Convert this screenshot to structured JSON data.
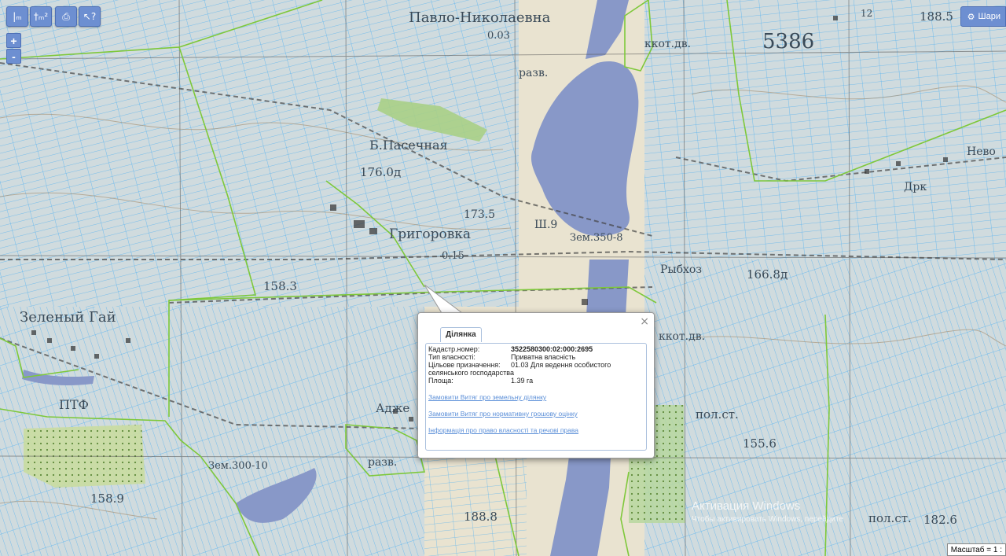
{
  "toolbar": {
    "buttons": [
      {
        "name": "measure-distance-button",
        "glyph": "|ₘ"
      },
      {
        "name": "measure-area-button",
        "glyph": "†ₘ²"
      },
      {
        "name": "print-button",
        "glyph": "⎙"
      },
      {
        "name": "info-cursor-button",
        "glyph": "↖?"
      }
    ],
    "zoom_in": "+",
    "zoom_out": "-",
    "share_label": "Шари"
  },
  "map_labels": [
    {
      "text": "Павло-Николаевна",
      "size": 18
    },
    {
      "text": "0.03",
      "size": 13
    },
    {
      "text": "разв.",
      "size": 14
    },
    {
      "text": "ккот.дв.",
      "size": 14
    },
    {
      "text": "5386",
      "size": 26
    },
    {
      "text": "188.5",
      "size": 15
    },
    {
      "text": "12",
      "size": 12
    },
    {
      "text": "Б.Пасечная",
      "size": 16
    },
    {
      "text": "176.0д",
      "size": 15
    },
    {
      "text": "173.5",
      "size": 14
    },
    {
      "text": "Ш.9",
      "size": 14
    },
    {
      "text": "Григоровка",
      "size": 17
    },
    {
      "text": "0.15",
      "size": 13
    },
    {
      "text": "Зем.350-8",
      "size": 13
    },
    {
      "text": "Рыбхоз",
      "size": 14
    },
    {
      "text": "166.8д",
      "size": 15
    },
    {
      "text": "158.3",
      "size": 15
    },
    {
      "text": "Зеленый Гай",
      "size": 18
    },
    {
      "text": "ккот.дв.",
      "size": 14
    },
    {
      "text": "ПТФ",
      "size": 16
    },
    {
      "text": "Адже",
      "size": 15
    },
    {
      "text": "пол.ст.",
      "size": 15
    },
    {
      "text": "155.6",
      "size": 15
    },
    {
      "text": "Зем.300-10",
      "size": 13
    },
    {
      "text": "разв.",
      "size": 14
    },
    {
      "text": "158.9",
      "size": 15
    },
    {
      "text": "188.8",
      "size": 15
    },
    {
      "text": "пол.ст.",
      "size": 15
    },
    {
      "text": "182.6",
      "size": 15
    },
    {
      "text": "Дрк",
      "size": 14
    },
    {
      "text": "Нево",
      "size": 14
    }
  ],
  "popup": {
    "tab": "Ділянка",
    "close": "×",
    "fields": [
      {
        "label": "Кадастр.номер:",
        "value": "3522580300:02:000:2695",
        "bold": true
      },
      {
        "label": "Тип власності:",
        "value": "Приватна власність",
        "bold": false
      },
      {
        "label": "Цільове призначення:",
        "value": "01.03 Для ведення особистого",
        "bold": false
      },
      {
        "label": "",
        "value": "селянського господарства",
        "bold": false
      },
      {
        "label": "Площа:",
        "value": "1.39 га",
        "bold": false
      }
    ],
    "links": [
      "Замовити Витяг про земельну ділянку",
      "Замовити Витяг про нормативну грошову оцінку",
      "Інформація про право власності та речові права"
    ]
  },
  "watermark": {
    "title": "Активация Windows",
    "subtitle": "Чтобы активировать Windows, перейдите"
  },
  "scale_text": "Масштаб = 1 :",
  "colors": {
    "parcel_line": "#5ab4f0",
    "boundary_line": "#7ec83a",
    "water": "#8898c8",
    "terrain": "#e9e3d0",
    "button": "#6d8fd1"
  }
}
